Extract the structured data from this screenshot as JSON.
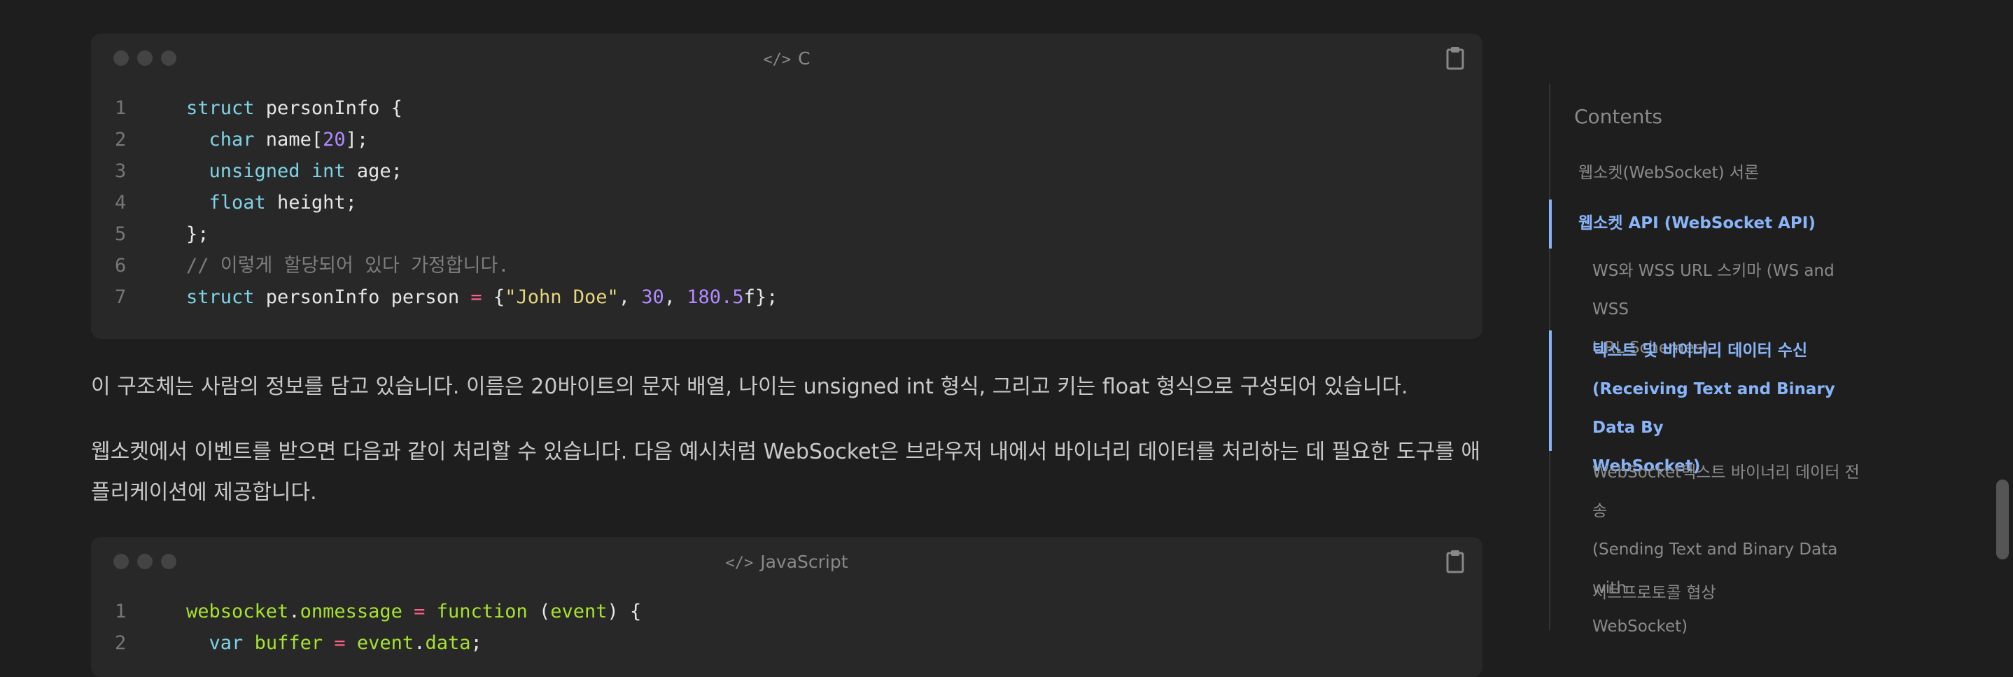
{
  "code_blocks": [
    {
      "language": "C",
      "lines": [
        {
          "n": "1",
          "tokens": [
            [
              "kw",
              "struct"
            ],
            [
              "code",
              " personInfo {"
            ]
          ]
        },
        {
          "n": "2",
          "tokens": [
            [
              "code",
              "  "
            ],
            [
              "kw",
              "char"
            ],
            [
              "code",
              " name["
            ],
            [
              "num",
              "20"
            ],
            [
              "code",
              "];"
            ]
          ]
        },
        {
          "n": "3",
          "tokens": [
            [
              "code",
              "  "
            ],
            [
              "kw",
              "unsigned"
            ],
            [
              "code",
              " "
            ],
            [
              "kw",
              "int"
            ],
            [
              "code",
              " age;"
            ]
          ]
        },
        {
          "n": "4",
          "tokens": [
            [
              "code",
              "  "
            ],
            [
              "kw",
              "float"
            ],
            [
              "code",
              " height;"
            ]
          ]
        },
        {
          "n": "5",
          "tokens": [
            [
              "code",
              "};"
            ]
          ]
        },
        {
          "n": "6",
          "tokens": [
            [
              "cm",
              "// 이렇게 할당되어 있다 가정합니다."
            ]
          ]
        },
        {
          "n": "7",
          "tokens": [
            [
              "kw",
              "struct"
            ],
            [
              "code",
              " personInfo person "
            ],
            [
              "op",
              "="
            ],
            [
              "code",
              " {"
            ],
            [
              "str",
              "\"John Doe\""
            ],
            [
              "code",
              ", "
            ],
            [
              "num",
              "30"
            ],
            [
              "code",
              ", "
            ],
            [
              "num",
              "180.5"
            ],
            [
              "code",
              "f};"
            ]
          ]
        }
      ]
    },
    {
      "language": "JavaScript",
      "lines": [
        {
          "n": "1",
          "tokens": [
            [
              "fn",
              "websocket"
            ],
            [
              "code",
              "."
            ],
            [
              "fn",
              "onmessage"
            ],
            [
              "code",
              " "
            ],
            [
              "op",
              "="
            ],
            [
              "code",
              " "
            ],
            [
              "fn",
              "function"
            ],
            [
              "code",
              " ("
            ],
            [
              "fn",
              "event"
            ],
            [
              "code",
              ") {"
            ]
          ]
        },
        {
          "n": "2",
          "tokens": [
            [
              "code",
              "  "
            ],
            [
              "kw",
              "var"
            ],
            [
              "code",
              " "
            ],
            [
              "fn",
              "buffer"
            ],
            [
              "code",
              " "
            ],
            [
              "op",
              "="
            ],
            [
              "code",
              " "
            ],
            [
              "fn",
              "event"
            ],
            [
              "code",
              "."
            ],
            [
              "fn",
              "data"
            ],
            [
              "code",
              ";"
            ]
          ]
        }
      ]
    }
  ],
  "paragraphs": {
    "p1": "이 구조체는 사람의 정보를 담고 있습니다. 이름은 20바이트의 문자 배열, 나이는 unsigned int 형식, 그리고 키는 float 형식으로 구성되어 있습니다.",
    "p2": "웹소켓에서 이벤트를 받으면 다음과 같이 처리할 수 있습니다. 다음 예시처럼 WebSocket은 브라우저 내에서 바이너리 데이터를 처리하는 데 필요한 도구를 애플리케이션에 제공합니다."
  },
  "toc": {
    "title": "Contents",
    "items": [
      {
        "label": "웹소켓(WebSocket) 서론",
        "active": false
      },
      {
        "label": "웹소켓 API (WebSocket API)",
        "active": true
      },
      {
        "label": "WS와 WSS URL 스키마 (WS and WSS URL Schemes)",
        "active": false
      },
      {
        "label": "텍스트 및 바이너리 데이터 수신 (Receiving Text and Binary Data By WebSocket)",
        "active": true
      },
      {
        "label": "WebSocket텍스트 바이너리 데이터 전송 (Sending Text and Binary Data with WebSocket)",
        "active": false
      },
      {
        "label": "서브프로토콜 협상",
        "active": false
      }
    ],
    "item_lines": [
      [
        "웹소켓(WebSocket) 서론"
      ],
      [
        "웹소켓 API (WebSocket API)"
      ],
      [
        "WS와 WSS URL 스키마 (WS and WSS",
        "URL Schemes)"
      ],
      [
        "텍스트 및 바이너리 데이터 수신",
        "(Receiving Text and Binary Data By",
        "WebSocket)"
      ],
      [
        "WebSocket텍스트 바이너리 데이터 전송",
        "(Sending Text and Binary Data with",
        "WebSocket)"
      ],
      [
        "서브프로토콜 협상"
      ]
    ]
  },
  "icons": {
    "code": "code-icon",
    "copy": "clipboard-icon"
  },
  "colors": {
    "accent": "#8ab4f8",
    "background": "#1e1e1e",
    "code_background": "#282828"
  }
}
